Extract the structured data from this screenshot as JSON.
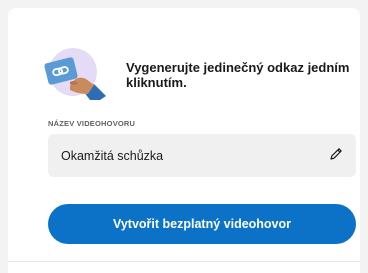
{
  "hero": {
    "title": "Vygenerujte jedinečný odkaz jedním kliknutím."
  },
  "meeting_name": {
    "label": "NÁZEV VIDEOHOVORU",
    "value": "Okamžitá schůzka"
  },
  "cta": {
    "label": "Vytvořit bezplatný videohovor"
  },
  "colors": {
    "accent": "#0b72c8",
    "hero_circle": "#e4dcf6",
    "hero_card": "#5b9bd5",
    "hand": "#c98a5e"
  },
  "icons": {
    "hero": "hand-holding-link-card-icon",
    "edit": "pencil-icon"
  }
}
